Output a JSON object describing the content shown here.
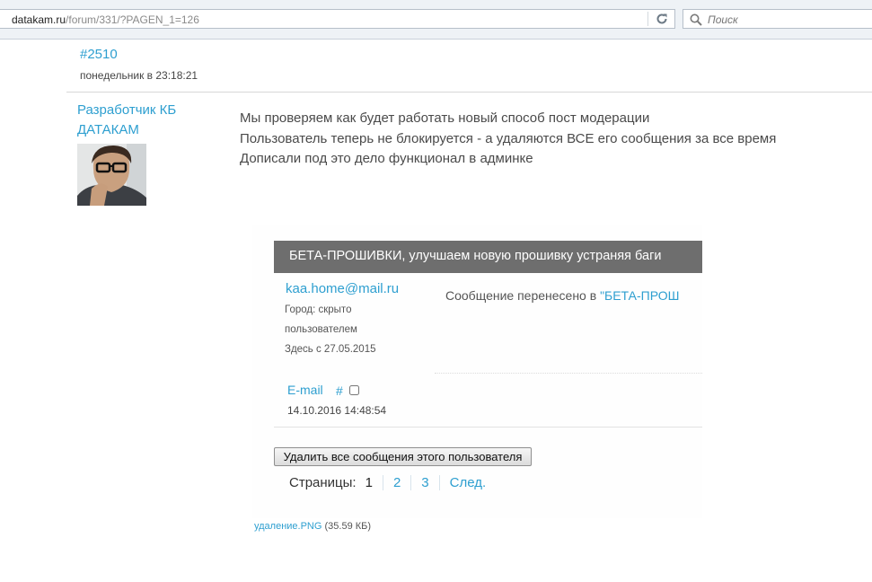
{
  "browser": {
    "url_domain": "datakam.ru",
    "url_path": "/forum/331/?PAGEN_1=126",
    "search_placeholder": "Поиск"
  },
  "post": {
    "number": "#2510",
    "date": "понедельник в 23:18:21",
    "author_line1": "Разработчик КБ",
    "author_line2": "ДАТАКАМ",
    "message": [
      "Мы проверяем как будет работать новый способ пост модерации",
      "Пользователь теперь не блокируется - а удаляются ВСЕ его сообщения за все время",
      "Дописали под это дело функционал в админке"
    ]
  },
  "screenshot": {
    "banner": "БЕТА-ПРОШИВКИ, улучшаем новую прошивку устраняя баги",
    "user_email": "kaa.home@mail.ru",
    "city_label": "Город: скрыто",
    "city_label2": "пользователем",
    "since": "Здесь с 27.05.2015",
    "moved_text": "Сообщение перенесено в ",
    "moved_link": "\"БЕТА-ПРОШ",
    "email_link": "E-mail",
    "hash": "#",
    "post_date": "14.10.2016 14:48:54",
    "delete_button": "Удалить все сообщения этого пользователя",
    "pages_label": "Страницы:",
    "current_page": "1",
    "pages": [
      "2",
      "3"
    ],
    "next": "След."
  },
  "attachment": {
    "name": "удаление.PNG",
    "size": "(35.59 КБ)"
  }
}
